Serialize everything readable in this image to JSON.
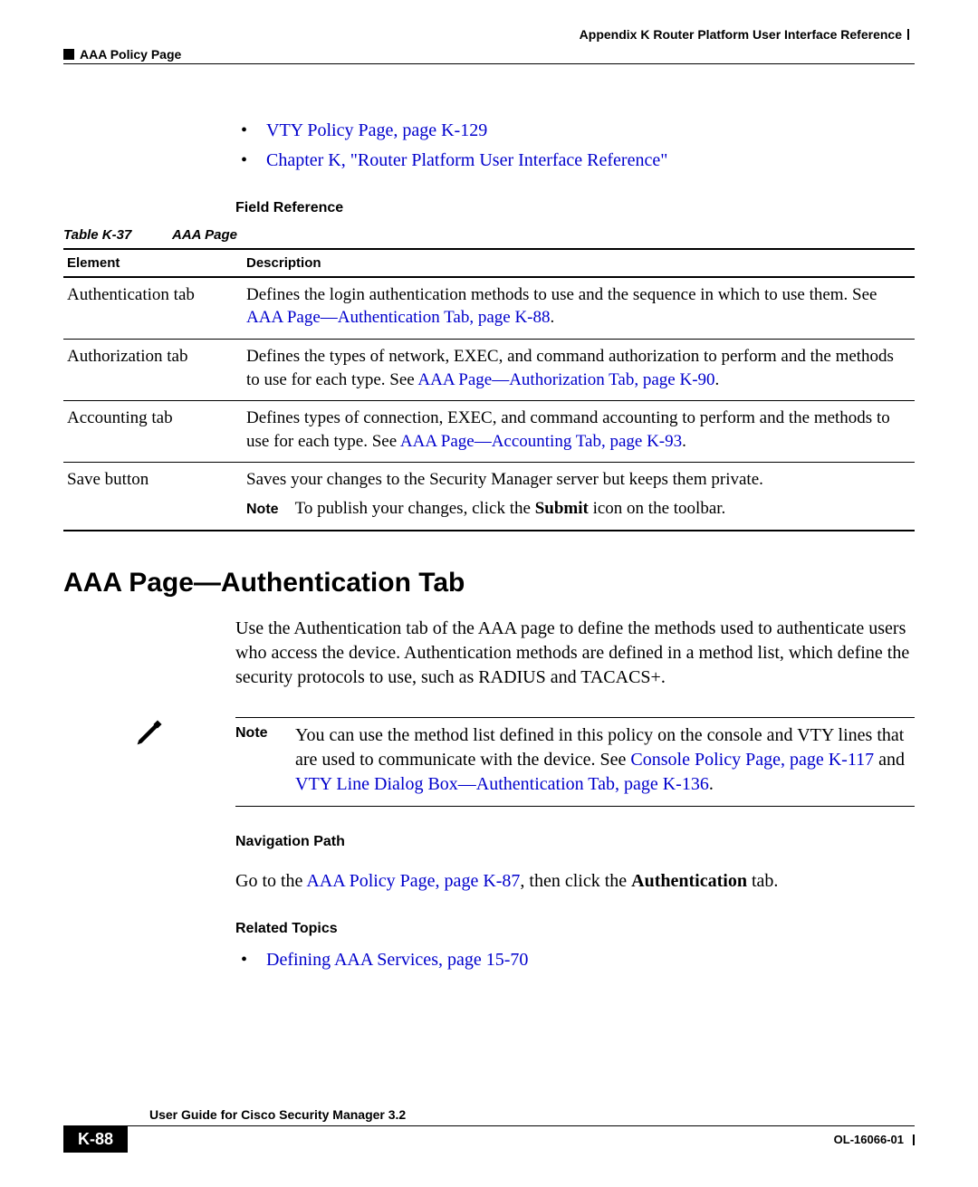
{
  "header": {
    "appendix_line": "Appendix K      Router Platform User Interface Reference",
    "section_label": "AAA Policy Page"
  },
  "top_links": [
    "VTY Policy Page, page K-129",
    "Chapter K, \"Router Platform User Interface Reference\""
  ],
  "field_ref_heading": "Field Reference",
  "table_caption_num": "Table K-37",
  "table_caption_title": "AAA Page",
  "table": {
    "head_element": "Element",
    "head_description": "Description",
    "rows": [
      {
        "element": "Authentication tab",
        "desc_pre": "Defines the login authentication methods to use and the sequence in which to use them. See ",
        "link": "AAA Page—Authentication Tab, page K-88",
        "desc_post": "."
      },
      {
        "element": "Authorization tab",
        "desc_pre": "Defines the types of network, EXEC, and command authorization to perform and the methods to use for each type. See ",
        "link": "AAA Page—Authorization Tab, page K-90",
        "desc_post": "."
      },
      {
        "element": "Accounting tab",
        "desc_pre": "Defines types of connection, EXEC, and command accounting to perform and the methods to use for each type. See ",
        "link": "AAA Page—Accounting Tab, page K-93",
        "desc_post": "."
      }
    ],
    "save_row": {
      "element": "Save button",
      "line1": "Saves your changes to the Security Manager server but keeps them private.",
      "note_label": "Note",
      "note_pre": "To publish your changes, click the ",
      "note_bold": "Submit",
      "note_post": " icon on the toolbar."
    }
  },
  "section_heading": "AAA Page—Authentication Tab",
  "para1": "Use the Authentication tab of the AAA page to define the methods used to authenticate users who access the device. Authentication methods are defined in a method list, which define the security protocols to use, such as RADIUS and TACACS+.",
  "note": {
    "label": "Note",
    "pre": "You can use the method list defined in this policy on the console and VTY lines that are used to communicate with the device. See ",
    "link1": "Console Policy Page, page K-117",
    "mid": " and ",
    "link2": "VTY Line Dialog Box—Authentication Tab, page K-136",
    "post": "."
  },
  "nav_heading": "Navigation Path",
  "nav": {
    "pre": "Go to the ",
    "link": "AAA Policy Page, page K-87",
    "mid": ", then click the ",
    "bold": "Authentication",
    "post": " tab."
  },
  "related_heading": "Related Topics",
  "related_link": "Defining AAA Services, page 15-70",
  "footer": {
    "guide": "User Guide for Cisco Security Manager 3.2",
    "page": "K-88",
    "docnum": "OL-16066-01"
  }
}
